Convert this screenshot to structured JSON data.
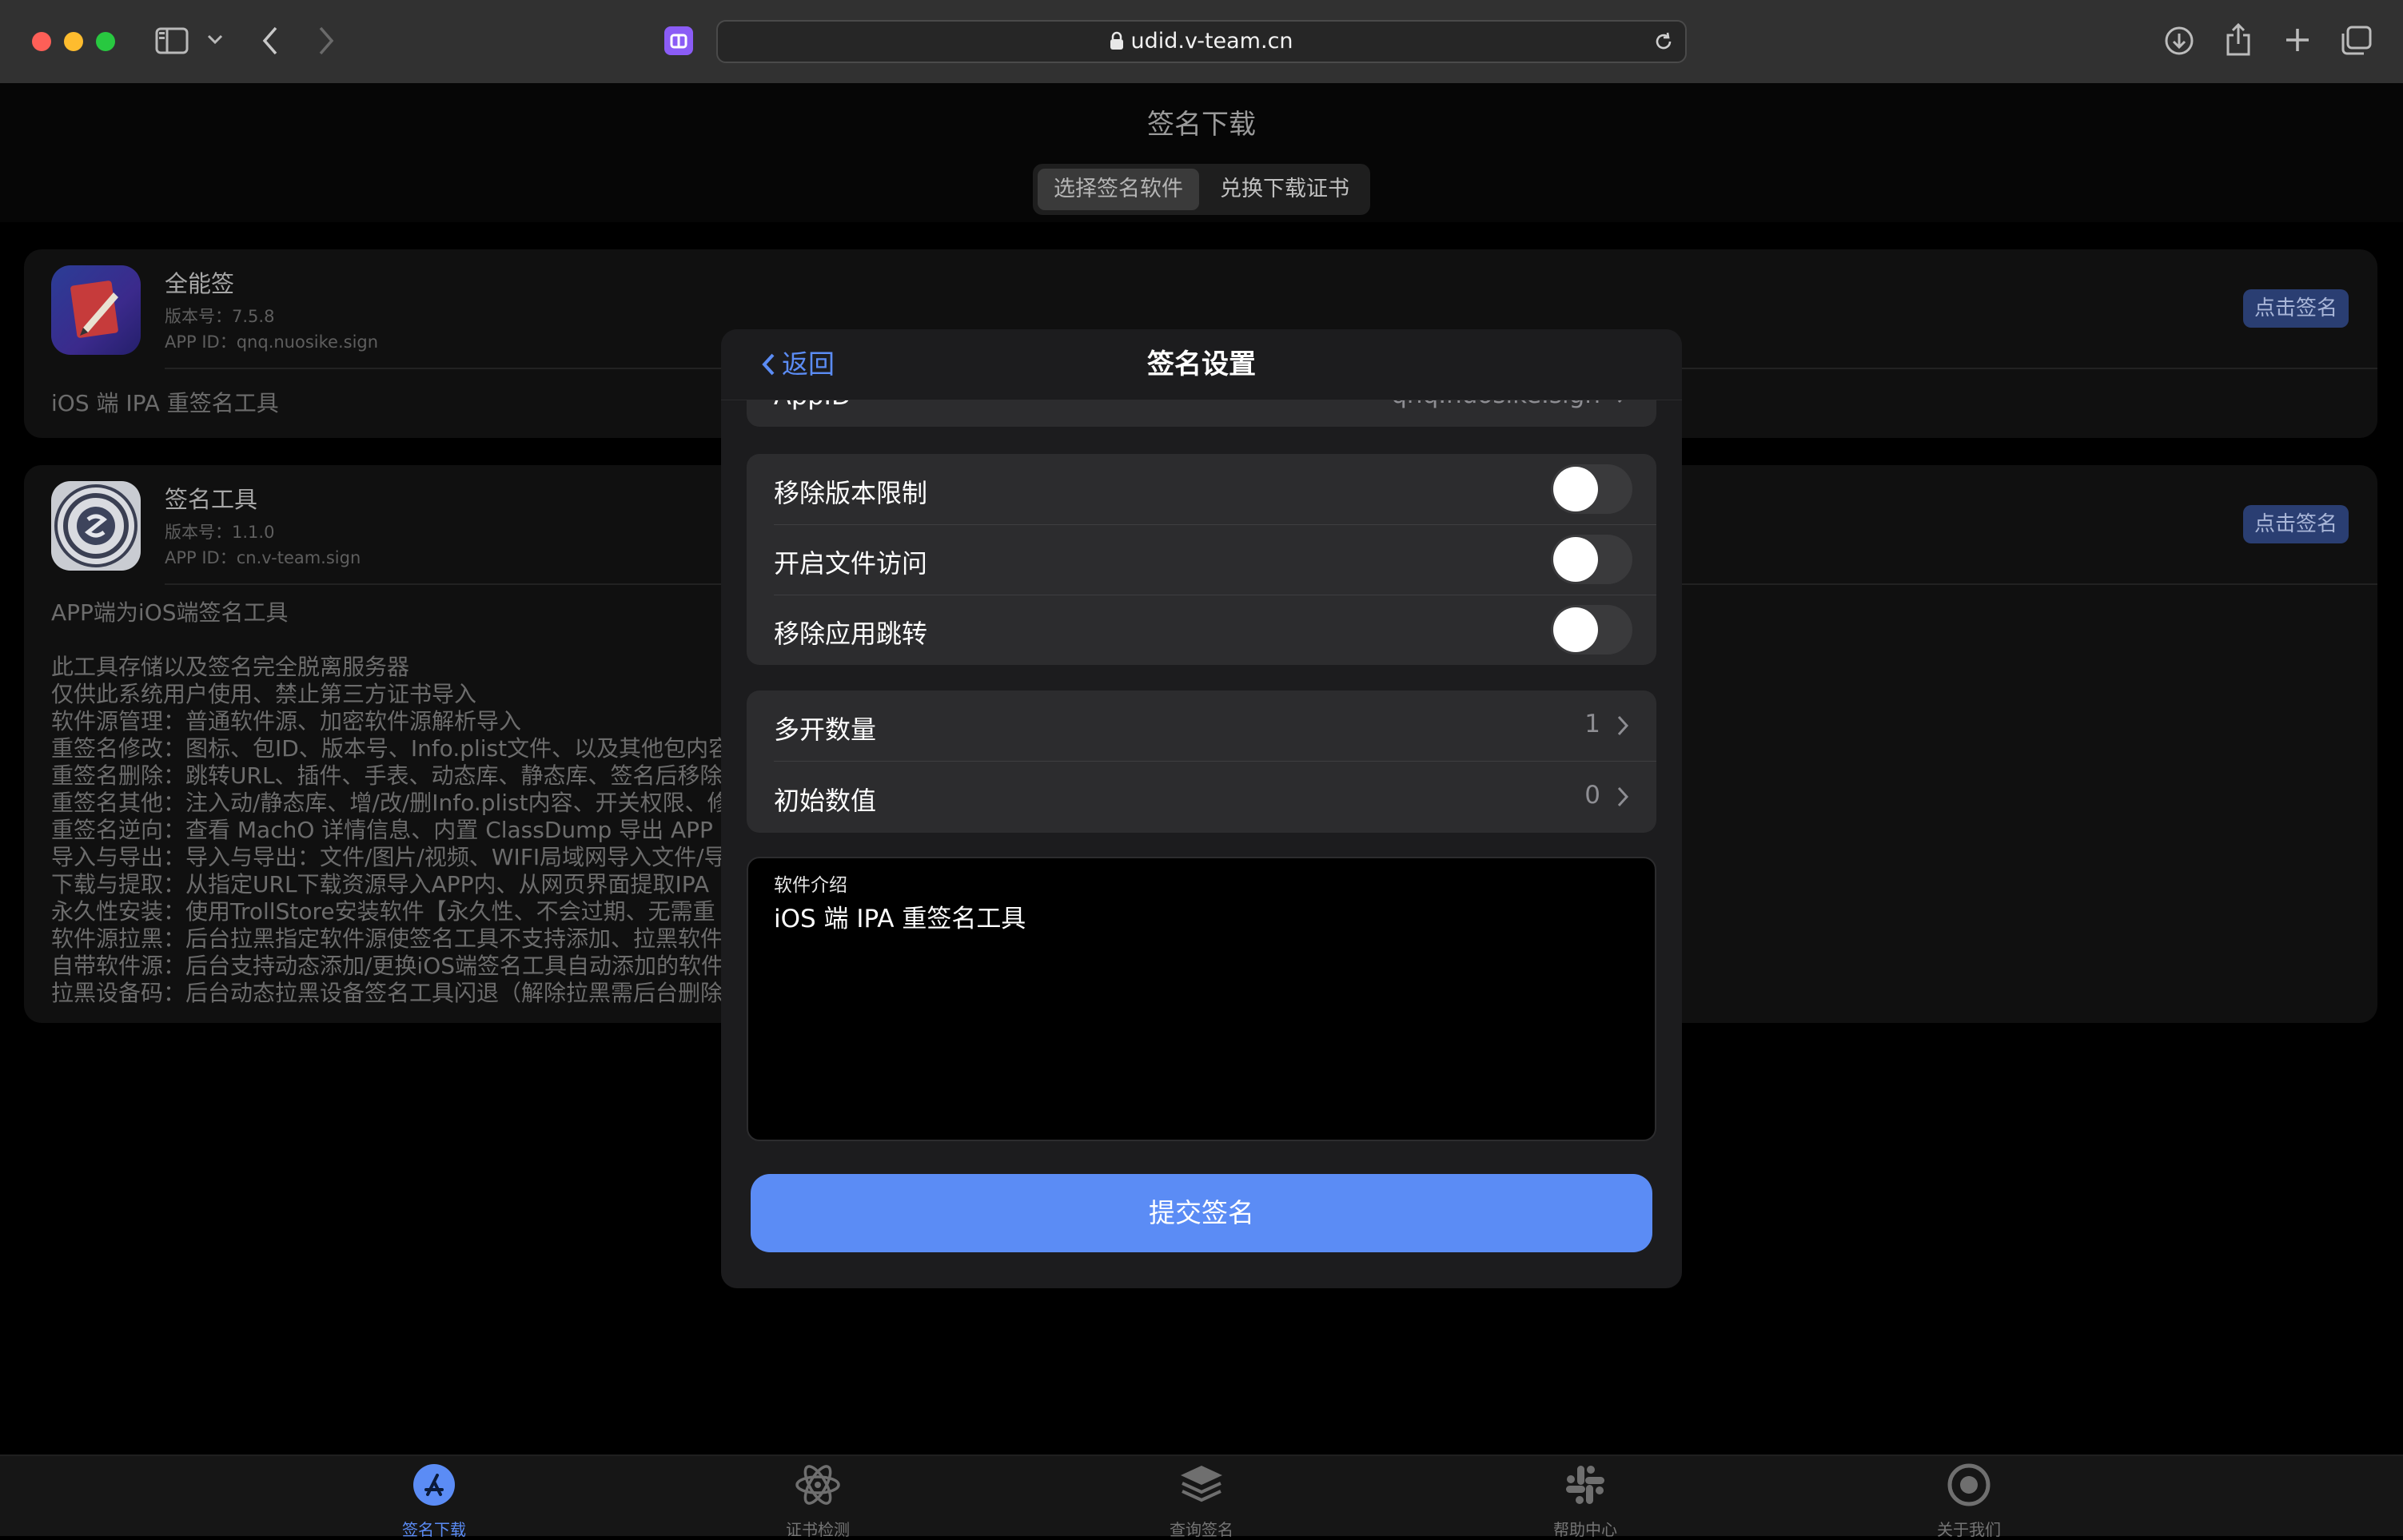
{
  "browser": {
    "url": "udid.v-team.cn"
  },
  "page": {
    "title": "签名下载",
    "tabs": [
      {
        "label": "选择签名软件",
        "active": true
      },
      {
        "label": "兑换下载证书",
        "active": false
      }
    ]
  },
  "apps": [
    {
      "name": "全能签",
      "version": "版本号：7.5.8",
      "app_id": "APP ID：qnq.nuosike.sign",
      "sign_label": "点击签名",
      "desc": "iOS 端 IPA 重签名工具"
    },
    {
      "name": "签名工具",
      "version": "版本号：1.1.0",
      "app_id": "APP ID：cn.v-team.sign",
      "sign_label": "点击签名",
      "desc_lines": [
        "APP端为iOS端签名工具",
        "",
        "此工具存储以及签名完全脱离服务器",
        "仅供此系统用户使用、禁止第三方证书导入",
        "软件源管理：普通软件源、加密软件源解析导入",
        "重签名修改：图标、包ID、版本号、Info.plist文件、以及其他包内容",
        "重签名删除：跳转URL、插件、手表、动态库、静态库、签名后移除",
        "重签名其他：注入动/静态库、增/改/删Info.plist内容、开关权限、修",
        "重签名逆向：查看 MachO 详情信息、内置 ClassDump 导出 APP 头",
        "导入与导出：导入与导出：文件/图片/视频、WIFI局域网导入文件/导",
        "下载与提取：从指定URL下载资源导入APP内、从网页界面提取IPA",
        "永久性安装：使用TrollStore安装软件【永久性、不会过期、无需重",
        "软件源拉黑：后台拉黑指定软件源使签名工具不支持添加、拉黑软件",
        "自带软件源：后台支持动态添加/更换iOS端签名工具自动添加的软件",
        "拉黑设备码：后台动态拉黑设备签名工具闪退（解除拉黑需后台删除"
      ]
    }
  ],
  "modal": {
    "title": "签名设置",
    "back_label": "返回",
    "appid_row": {
      "label": "AppID",
      "value": "qnq.nuosike.sign"
    },
    "toggles": [
      {
        "label": "移除版本限制",
        "on": false
      },
      {
        "label": "开启文件访问",
        "on": false
      },
      {
        "label": "移除应用跳转",
        "on": false
      }
    ],
    "counters": [
      {
        "label": "多开数量",
        "value": "1"
      },
      {
        "label": "初始数值",
        "value": "0"
      }
    ],
    "description": {
      "label": "软件介绍",
      "value": "iOS 端 IPA 重签名工具"
    },
    "submit_label": "提交签名"
  },
  "tabbar": [
    {
      "label": "签名下载",
      "icon": "appstore-icon",
      "active": true
    },
    {
      "label": "证书检测",
      "icon": "atom-icon",
      "active": false
    },
    {
      "label": "查询签名",
      "icon": "layers-icon",
      "active": false
    },
    {
      "label": "帮助中心",
      "icon": "slack-icon",
      "active": false
    },
    {
      "label": "关于我们",
      "icon": "record-icon",
      "active": false
    }
  ],
  "colors": {
    "accent": "#5b8cf5",
    "sign_button": "#2a3e72",
    "tab_active": "#5b8cf5",
    "traffic_red": "#fe5f57",
    "traffic_yellow": "#febc2e",
    "traffic_green": "#28c840"
  }
}
